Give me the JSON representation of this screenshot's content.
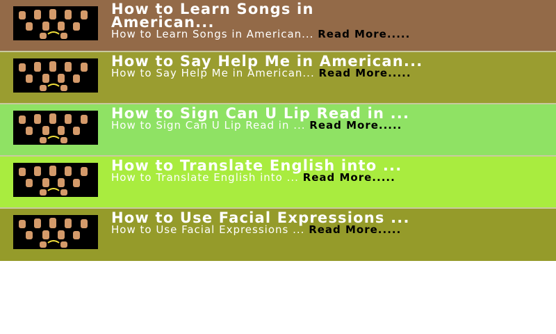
{
  "items": [
    {
      "title": "How to Learn Songs in\nAmerican...",
      "subtitle": "How to Learn Songs in American... ",
      "read_more": "Read More.....",
      "bg": "#936a48"
    },
    {
      "title": "How to Say Help Me in American...",
      "subtitle": "How to Say Help Me in American... ",
      "read_more": "Read More.....",
      "bg": "#9a9d30"
    },
    {
      "title": "How to Sign Can U Lip Read in ...",
      "subtitle": "How to Sign Can U Lip Read in ... ",
      "read_more": "Read More.....",
      "bg": "#8fe264"
    },
    {
      "title": "How to Translate English into ...",
      "subtitle": "How to Translate English into ... ",
      "read_more": "Read More.....",
      "bg": "#a9ec3f"
    },
    {
      "title": "How to Use Facial Expressions ...",
      "subtitle": "How to Use Facial Expressions ... ",
      "read_more": "Read More.....",
      "bg": "#959b2a"
    }
  ],
  "icons": {
    "thumbnail": "sign-language-hands-icon"
  }
}
